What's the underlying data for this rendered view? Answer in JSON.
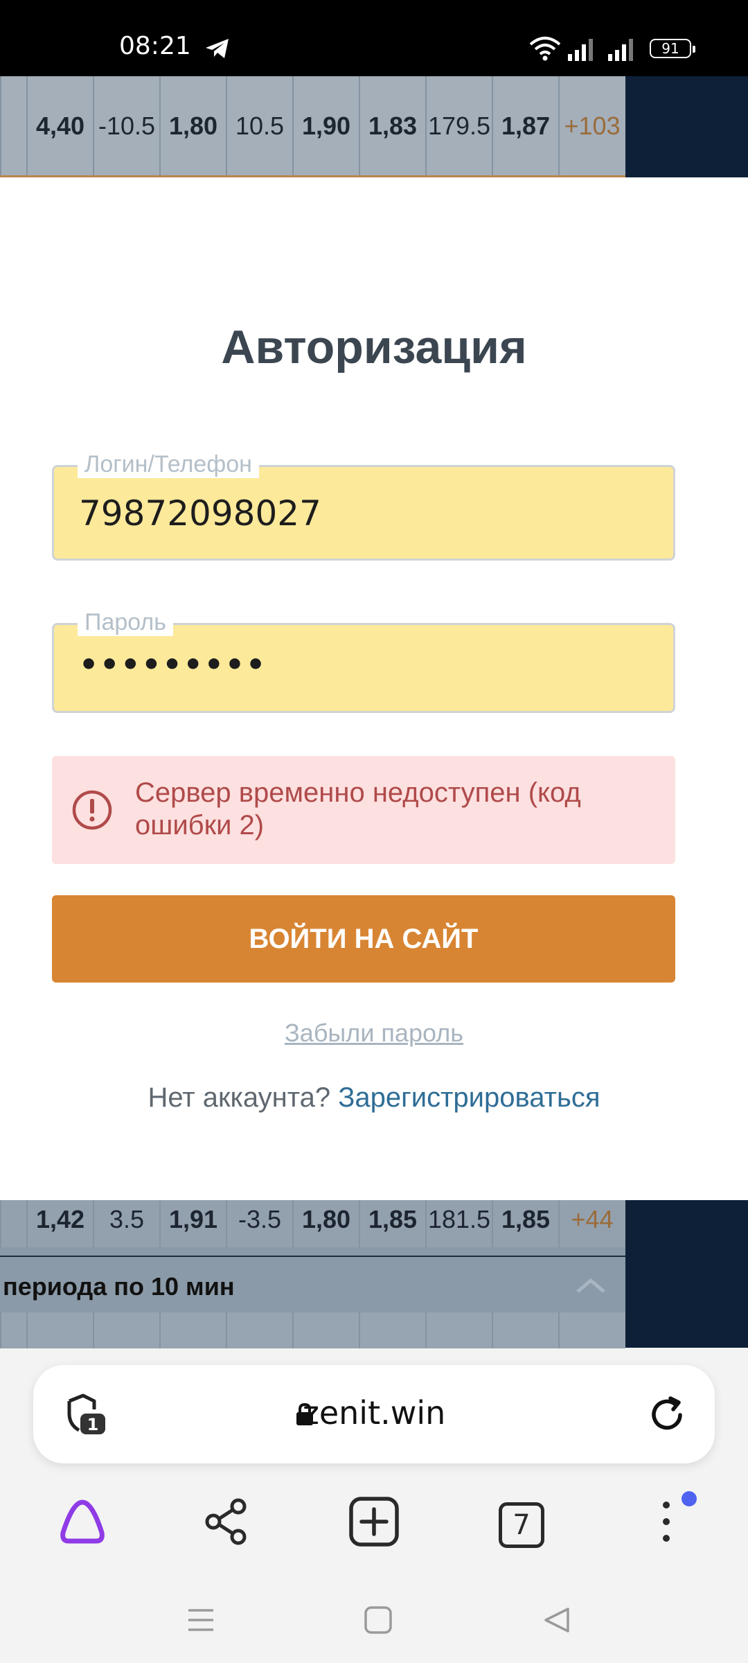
{
  "status_bar": {
    "time": "08:21",
    "battery": "91",
    "icons": [
      "telegram-icon",
      "wifi-icon",
      "signal-icon",
      "signal-icon",
      "battery-icon"
    ]
  },
  "background": {
    "odds_top": [
      "4,40",
      "-10.5",
      "1,80",
      "10.5",
      "1,90",
      "1,83",
      "179.5",
      "1,87",
      "+103"
    ],
    "odds_bottom": [
      "1,42",
      "3.5",
      "1,91",
      "-3.5",
      "1,80",
      "1,85",
      "181.5",
      "1,85",
      "+44"
    ],
    "period_label": "периода по 10 мин"
  },
  "modal": {
    "title": "Авторизация",
    "login": {
      "label": "Логин/Телефон",
      "value": "79872098027"
    },
    "password": {
      "label": "Пароль",
      "value": "•••••••••"
    },
    "error": {
      "text": "Сервер временно недоступен (код ошибки 2)"
    },
    "submit_label": "ВОЙТИ НА САЙТ",
    "forgot_label": "Забыли пароль",
    "no_account_label": "Нет аккаунта?",
    "register_label": "Зарегистрироваться"
  },
  "browser": {
    "url": "zenit.win",
    "protect_badge": "1",
    "tabs_count": "7"
  },
  "colors": {
    "accent_button": "#d88533",
    "field_fill": "#fde99a",
    "error_bg": "#fde0e0",
    "error_text": "#b04a4a",
    "link": "#2f6d96",
    "notification_dot": "#4f63f0"
  }
}
